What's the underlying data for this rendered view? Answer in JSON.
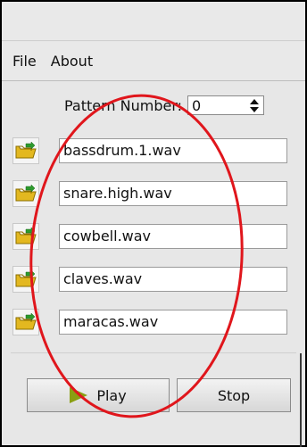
{
  "menu": {
    "items": [
      "File",
      "About"
    ]
  },
  "pattern": {
    "label": "Pattern Number:",
    "value": "0"
  },
  "files": [
    {
      "name": "bassdrum.1.wav"
    },
    {
      "name": "snare.high.wav"
    },
    {
      "name": "cowbell.wav"
    },
    {
      "name": "claves.wav"
    },
    {
      "name": "maracas.wav"
    }
  ],
  "controls": {
    "play_label": "Play",
    "stop_label": "Stop"
  },
  "icons": {
    "folder": "folder-open-icon",
    "play": "play-icon"
  },
  "colors": {
    "play_accent": "#8a9f12",
    "annotation": "#e0161c"
  }
}
